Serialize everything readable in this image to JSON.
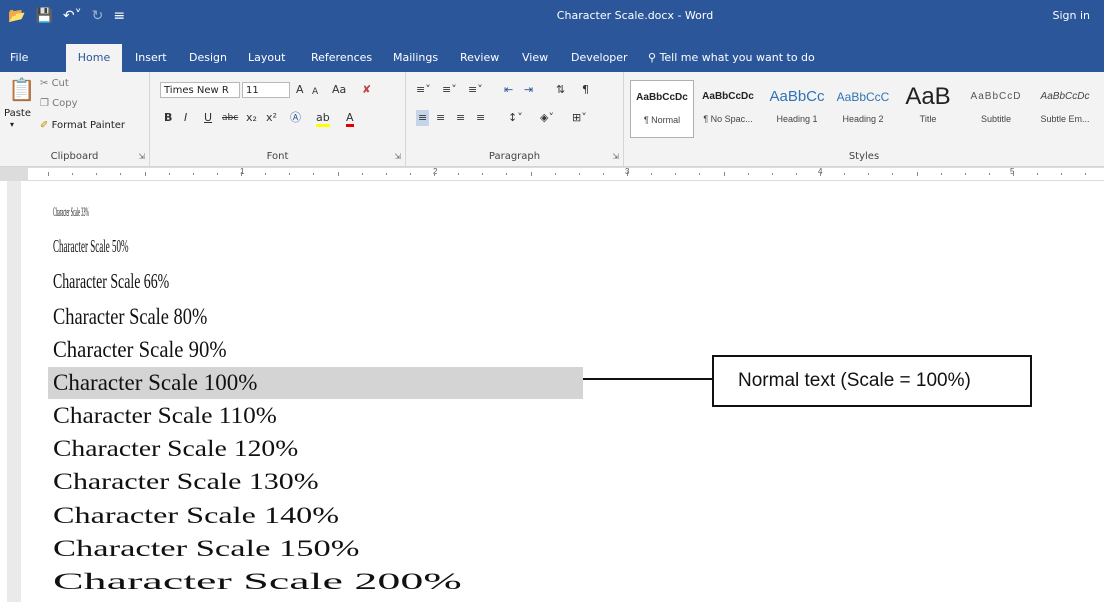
{
  "window": {
    "title": "Character Scale.docx  -  Word",
    "sign_in": "Sign in",
    "accent": "#2b579a"
  },
  "qat": {
    "icons": [
      "folder-icon",
      "save-icon",
      "undo-icon",
      "redo-icon",
      "customize-icon"
    ]
  },
  "tabs": [
    "File",
    "Home",
    "Insert",
    "Design",
    "Layout",
    "References",
    "Mailings",
    "Review",
    "View",
    "Developer"
  ],
  "active_tab": "Home",
  "tell_me": "Tell me what you want to do",
  "ribbon": {
    "clipboard": {
      "label": "Clipboard",
      "paste": "Paste",
      "cut": "Cut",
      "copy": "Copy",
      "format_painter": "Format Painter"
    },
    "font": {
      "label": "Font",
      "font_name": "Times New R",
      "font_size": "11",
      "grow": "A",
      "shrink": "A",
      "change_case": "Aa",
      "bold": "B",
      "italic": "I",
      "underline": "U",
      "strike": "abc",
      "subscript": "x₂",
      "superscript": "x²"
    },
    "paragraph": {
      "label": "Paragraph"
    },
    "styles": {
      "label": "Styles",
      "items": [
        {
          "sample": "AaBbCcDc",
          "name": "¶ Normal"
        },
        {
          "sample": "AaBbCcDc",
          "name": "¶ No Spac..."
        },
        {
          "sample": "AaBbCc",
          "name": "Heading 1"
        },
        {
          "sample": "AaBbCcC",
          "name": "Heading 2"
        },
        {
          "sample": "AaB",
          "name": "Title"
        },
        {
          "sample": "AaBbCcD",
          "name": "Subtitle"
        },
        {
          "sample": "AaBbCcDc",
          "name": "Subtle Em..."
        }
      ]
    }
  },
  "ruler": {
    "numbers": [
      "1",
      "2",
      "3",
      "4",
      "5"
    ]
  },
  "document": {
    "lines": [
      {
        "text": "Character Scale 33%",
        "scale": 33
      },
      {
        "text": "Character Scale 50%",
        "scale": 50
      },
      {
        "text": "Character Scale 66%",
        "scale": 66
      },
      {
        "text": "Character Scale 80%",
        "scale": 80
      },
      {
        "text": "Character Scale 90%",
        "scale": 90
      },
      {
        "text": "Character Scale 100%",
        "scale": 100
      },
      {
        "text": "Character Scale 110%",
        "scale": 110
      },
      {
        "text": "Character Scale 120%",
        "scale": 120
      },
      {
        "text": "Character Scale 130%",
        "scale": 130
      },
      {
        "text": "Character Scale 140%",
        "scale": 140
      },
      {
        "text": "Character Scale 150%",
        "scale": 150
      },
      {
        "text": "Character Scale 200%",
        "scale": 200
      }
    ],
    "highlighted_scale": 100,
    "callout": "Normal text (Scale = 100%)"
  }
}
